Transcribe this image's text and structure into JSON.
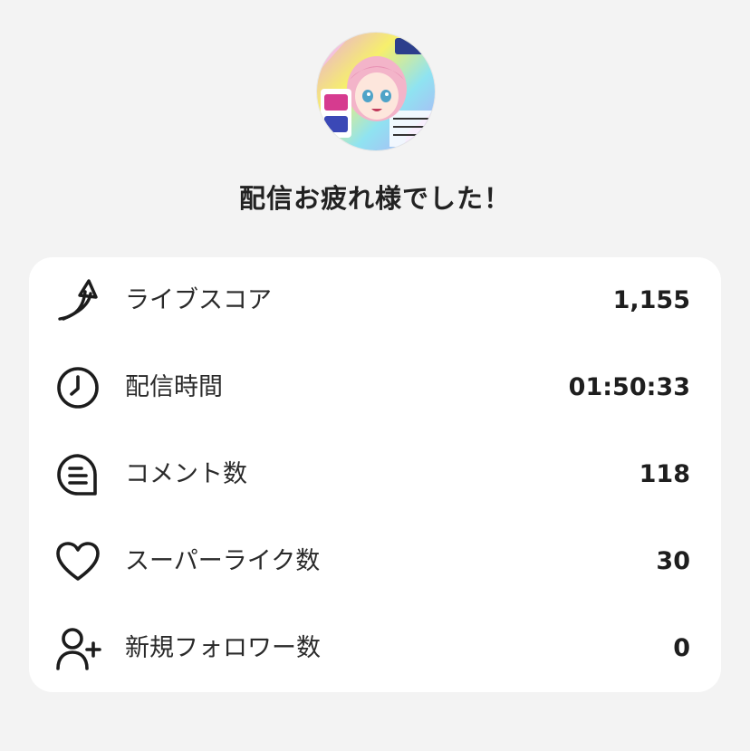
{
  "header": {
    "avatar_icon": "streamer-avatar-illustration",
    "title": "配信お疲れ様でした！"
  },
  "stats": [
    {
      "icon": "score-arrow-icon",
      "label": "ライブスコア",
      "value": "1,155"
    },
    {
      "icon": "clock-icon",
      "label": "配信時間",
      "value": "01:50:33"
    },
    {
      "icon": "comment-icon",
      "label": "コメント数",
      "value": "118"
    },
    {
      "icon": "heart-icon",
      "label": "スーパーライク数",
      "value": "30"
    },
    {
      "icon": "add-user-icon",
      "label": "新規フォロワー数",
      "value": "0"
    }
  ],
  "colors": {
    "background": "#f3f3f3",
    "card": "#ffffff",
    "text": "#1c1c1c"
  }
}
